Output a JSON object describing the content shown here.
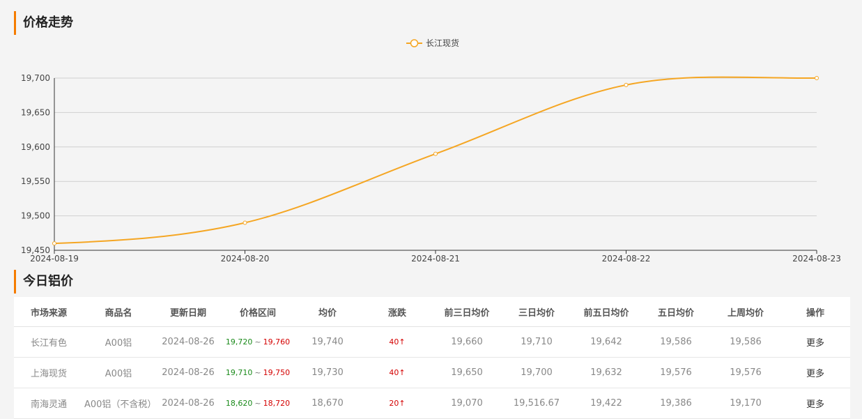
{
  "sections": {
    "trend_title": "价格走势",
    "today_title": "今日铝价"
  },
  "colors": {
    "accent": "#f57c00",
    "series": "#f5a623",
    "low": "#1a8a1a",
    "high": "#d40000"
  },
  "chart_data": {
    "type": "line",
    "title": "",
    "xlabel": "",
    "ylabel": "",
    "x": [
      "2024-08-19",
      "2024-08-20",
      "2024-08-21",
      "2024-08-22",
      "2024-08-23"
    ],
    "ylim": [
      19450,
      19700
    ],
    "yticks": [
      "19,450",
      "19,500",
      "19,550",
      "19,600",
      "19,650",
      "19,700"
    ],
    "grid": true,
    "legend": "top-center",
    "smooth": true,
    "series": [
      {
        "name": "长江现货",
        "values": [
          19460,
          19490,
          19590,
          19690,
          19700
        ]
      }
    ]
  },
  "table": {
    "headers": [
      "市场来源",
      "商品名",
      "更新日期",
      "价格区间",
      "均价",
      "涨跌",
      "前三日均价",
      "三日均价",
      "前五日均价",
      "五日均价",
      "上周均价",
      "操作"
    ],
    "range_separator": "~",
    "rows": [
      {
        "source": "长江有色",
        "product": "A00铝",
        "date": "2024-08-26",
        "low": "19,720",
        "high": "19,760",
        "avg": "19,740",
        "change": "40↑",
        "prev3": "19,660",
        "avg3": "19,710",
        "prev5": "19,642",
        "avg5": "19,586",
        "lastweek": "19,586",
        "action": "更多"
      },
      {
        "source": "上海现货",
        "product": "A00铝",
        "date": "2024-08-26",
        "low": "19,710",
        "high": "19,750",
        "avg": "19,730",
        "change": "40↑",
        "prev3": "19,650",
        "avg3": "19,700",
        "prev5": "19,632",
        "avg5": "19,576",
        "lastweek": "19,576",
        "action": "更多"
      },
      {
        "source": "南海灵通",
        "product": "A00铝（不含税）",
        "date": "2024-08-26",
        "low": "18,620",
        "high": "18,720",
        "avg": "18,670",
        "change": "20↑",
        "prev3": "19,070",
        "avg3": "19,516.67",
        "prev5": "19,422",
        "avg5": "19,386",
        "lastweek": "19,170",
        "action": "更多"
      }
    ]
  }
}
